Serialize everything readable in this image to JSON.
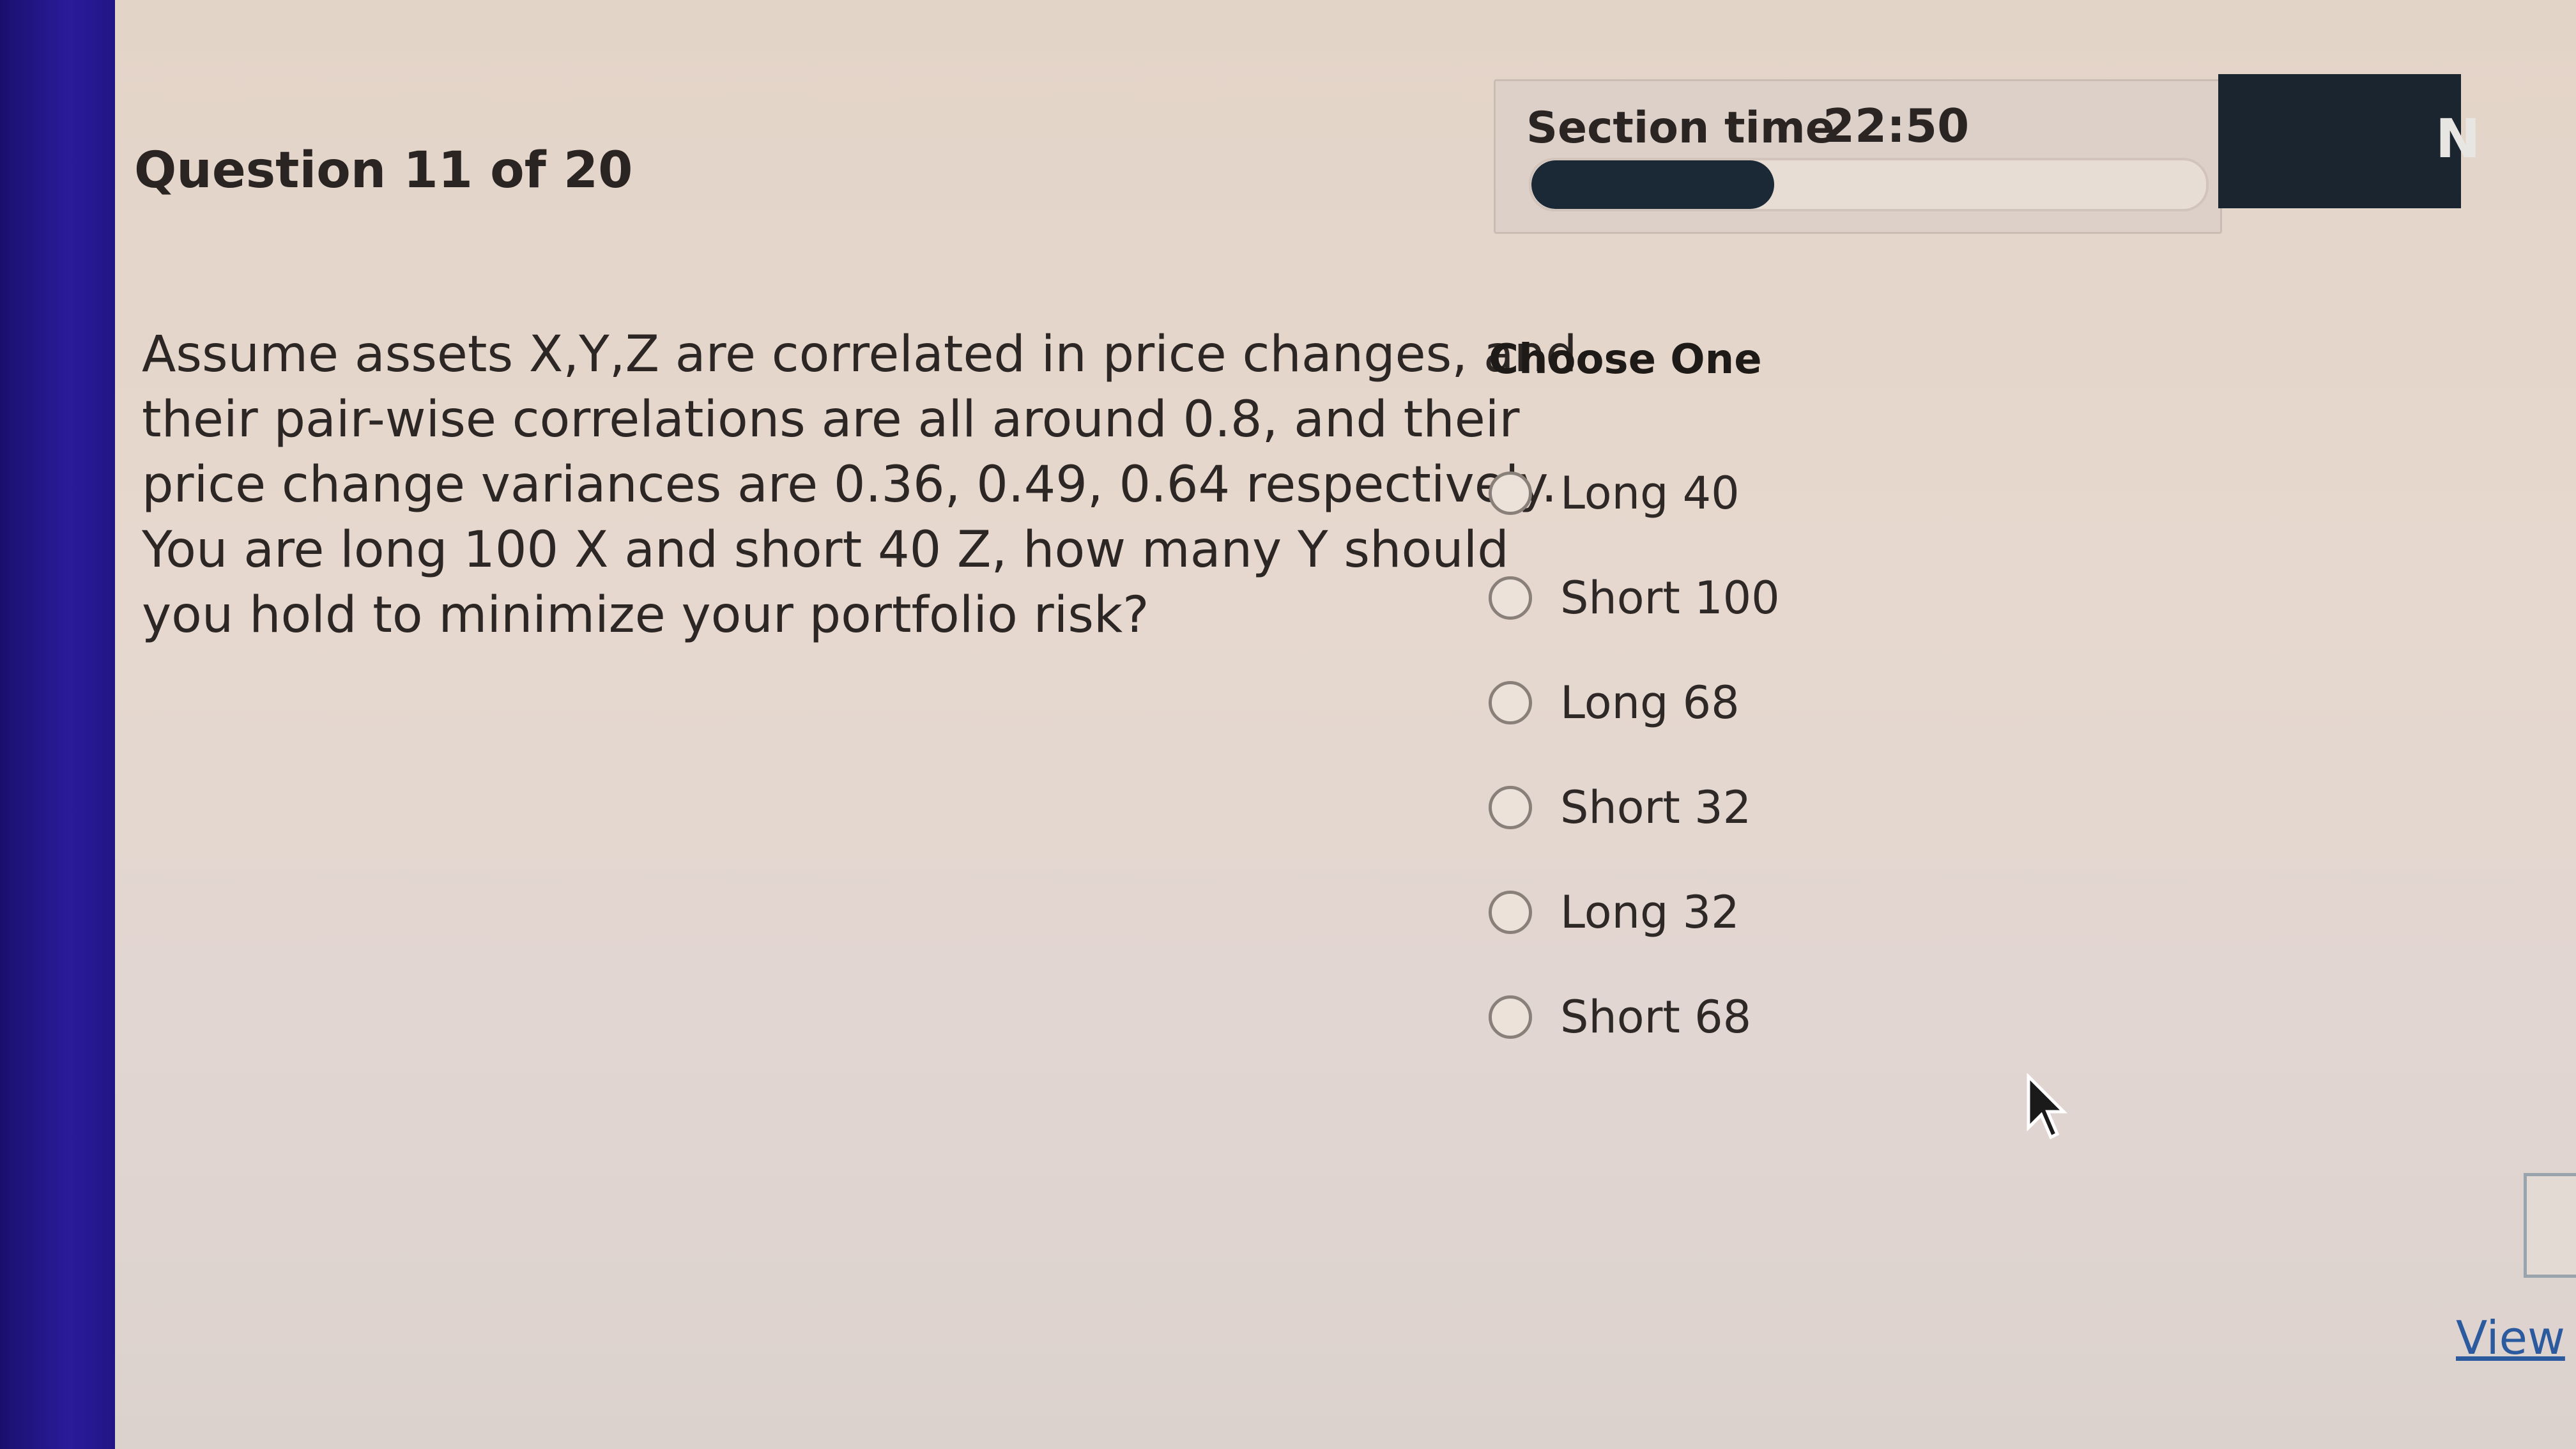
{
  "header": {
    "question_count": "Question 11 of 20",
    "section_time_label": "Section time",
    "section_time_value": "22:50",
    "time_progress_fraction": 0.36
  },
  "nav": {
    "next_partial": "N",
    "view_link": "View"
  },
  "question": {
    "text": "Assume assets X,Y,Z are correlated in price changes, and their pair-wise correlations are all around 0.8, and their price change variances are 0.36, 0.49, 0.64 respectively. You are long 100 X and short 40 Z, how many Y should you hold to minimize your portfolio risk?"
  },
  "answers": {
    "instruction": "Choose One",
    "options": [
      {
        "label": "Long 40"
      },
      {
        "label": "Short 100"
      },
      {
        "label": "Long 68"
      },
      {
        "label": "Short 32"
      },
      {
        "label": "Long 32"
      },
      {
        "label": "Short 68"
      }
    ]
  },
  "colors": {
    "progress_fill": "#1b2937",
    "link": "#2b5a9e"
  },
  "icons": {
    "cursor": "arrow-cursor-icon"
  }
}
